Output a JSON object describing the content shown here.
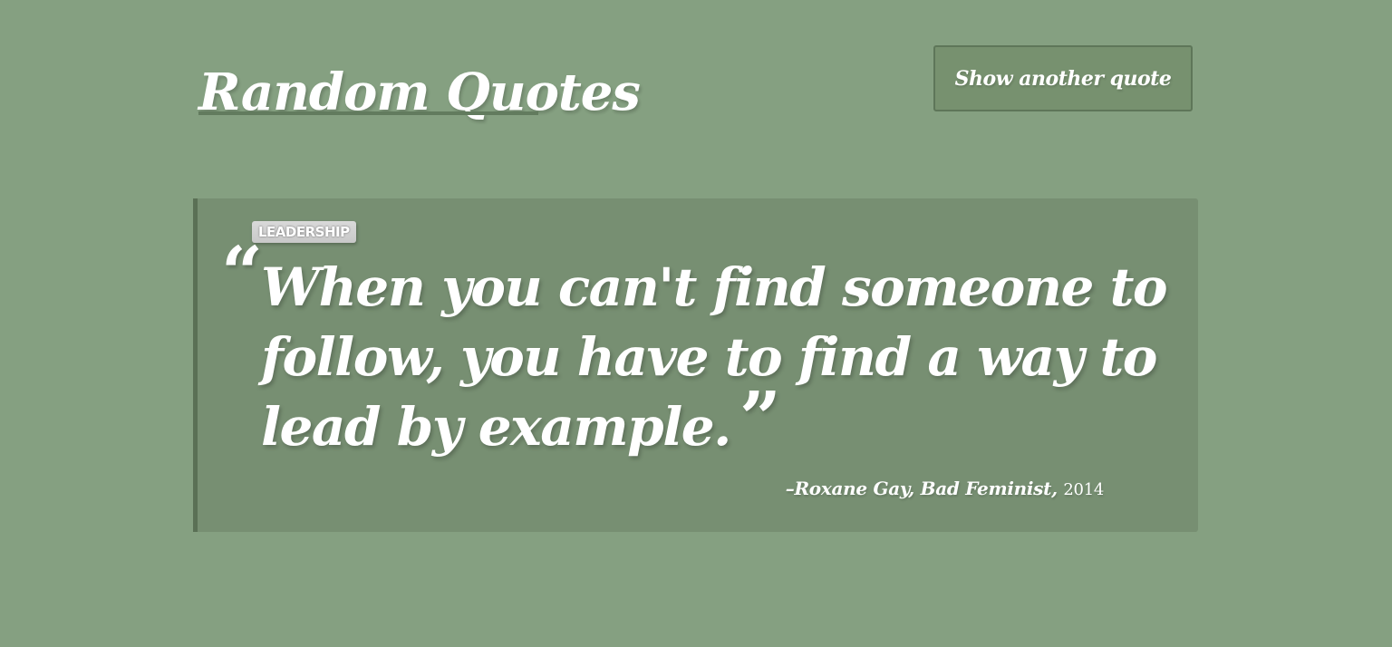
{
  "header": {
    "title": "Random Quotes"
  },
  "actions": {
    "show_another_label": "Show another quote"
  },
  "quote": {
    "tag": "LEADERSHIP",
    "open_mark": "“",
    "text": "When you can't find someone to follow, you have to find a way to lead by example.",
    "close_mark": "”",
    "author_prefix": "–",
    "author": "Roxane Gay",
    "source": "Bad Feminist",
    "year": "2014"
  },
  "colors": {
    "background": "#85a081",
    "quote_box": "#778f72",
    "accent_border": "#5a7055",
    "text": "#ffffff"
  }
}
